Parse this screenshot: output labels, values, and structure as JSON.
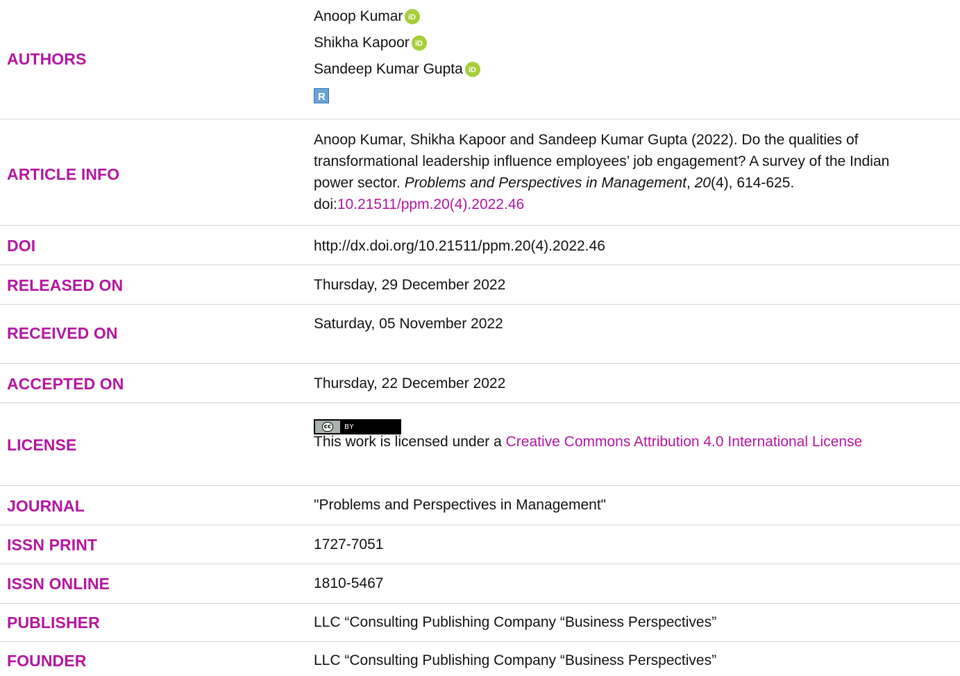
{
  "authors": {
    "label": "AUTHORS",
    "names": [
      "Anoop Kumar",
      "Shikha Kapoor",
      "Sandeep Kumar Gupta"
    ]
  },
  "article_info": {
    "label": "ARTICLE INFO",
    "text_1": "Anoop Kumar, Shikha Kapoor and Sandeep Kumar Gupta (2022). Do the qualities of transformational leadership influence employees’ job engagement? A survey of the Indian power sector. ",
    "journal_italic": "Problems and Perspectives in Management",
    "text_2": ", ",
    "volume_italic": "20",
    "text_3": "(4), 614-625. doi:",
    "doi_link": "10.21511/ppm.20(4).2022.46"
  },
  "doi": {
    "label": "DOI",
    "value": "http://dx.doi.org/10.21511/ppm.20(4).2022.46"
  },
  "released_on": {
    "label": "RELEASED ON",
    "value": "Thursday, 29 December 2022"
  },
  "received_on": {
    "label": "RECEIVED ON",
    "value": "Saturday, 05 November 2022"
  },
  "accepted_on": {
    "label": "ACCEPTED ON",
    "value": "Thursday, 22 December 2022"
  },
  "license": {
    "label": "LICENSE",
    "badge_cc": "cc",
    "badge_by": "BY",
    "text": "This work is licensed under a ",
    "link": "Creative Commons Attribution 4.0 International License"
  },
  "journal": {
    "label": "JOURNAL",
    "value": "\"Problems and Perspectives in Management\""
  },
  "issn_print": {
    "label": "ISSN PRINT",
    "value": "1727-7051"
  },
  "issn_online": {
    "label": "ISSN ONLINE",
    "value": "1810-5467"
  },
  "publisher": {
    "label": "PUBLISHER",
    "value": "LLC “Consulting Publishing Company “Business Perspectives”"
  },
  "founder": {
    "label": "FOUNDER",
    "value": "LLC “Consulting Publishing Company “Business Perspectives”"
  },
  "colors": {
    "label": "#b3169e",
    "text": "#111111",
    "orcid": "#a6ce39",
    "divider": "#d3d3d3"
  },
  "icons": {
    "orcid": "orcid-icon",
    "researchgate": "researchgate-icon",
    "license": "cc-by-badge-icon"
  }
}
